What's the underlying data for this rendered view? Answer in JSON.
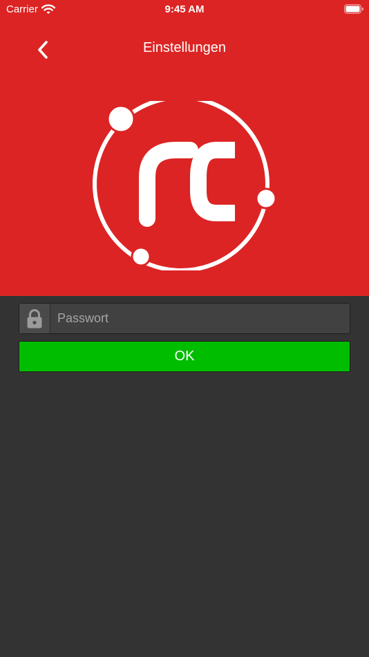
{
  "status_bar": {
    "carrier": "Carrier",
    "time": "9:45 AM",
    "wifi_icon": "wifi-icon",
    "battery_icon": "battery-icon"
  },
  "nav": {
    "title": "Einstellungen",
    "back_icon": "chevron-left-icon"
  },
  "logo": {
    "text": "rc"
  },
  "login": {
    "password_placeholder": "Passwort",
    "password_value": "",
    "lock_icon": "lock-icon",
    "ok_label": "OK"
  },
  "colors": {
    "header_background": "#dc2424",
    "page_background": "#333333",
    "ok_button": "#00bd00",
    "input_background": "#414141"
  }
}
